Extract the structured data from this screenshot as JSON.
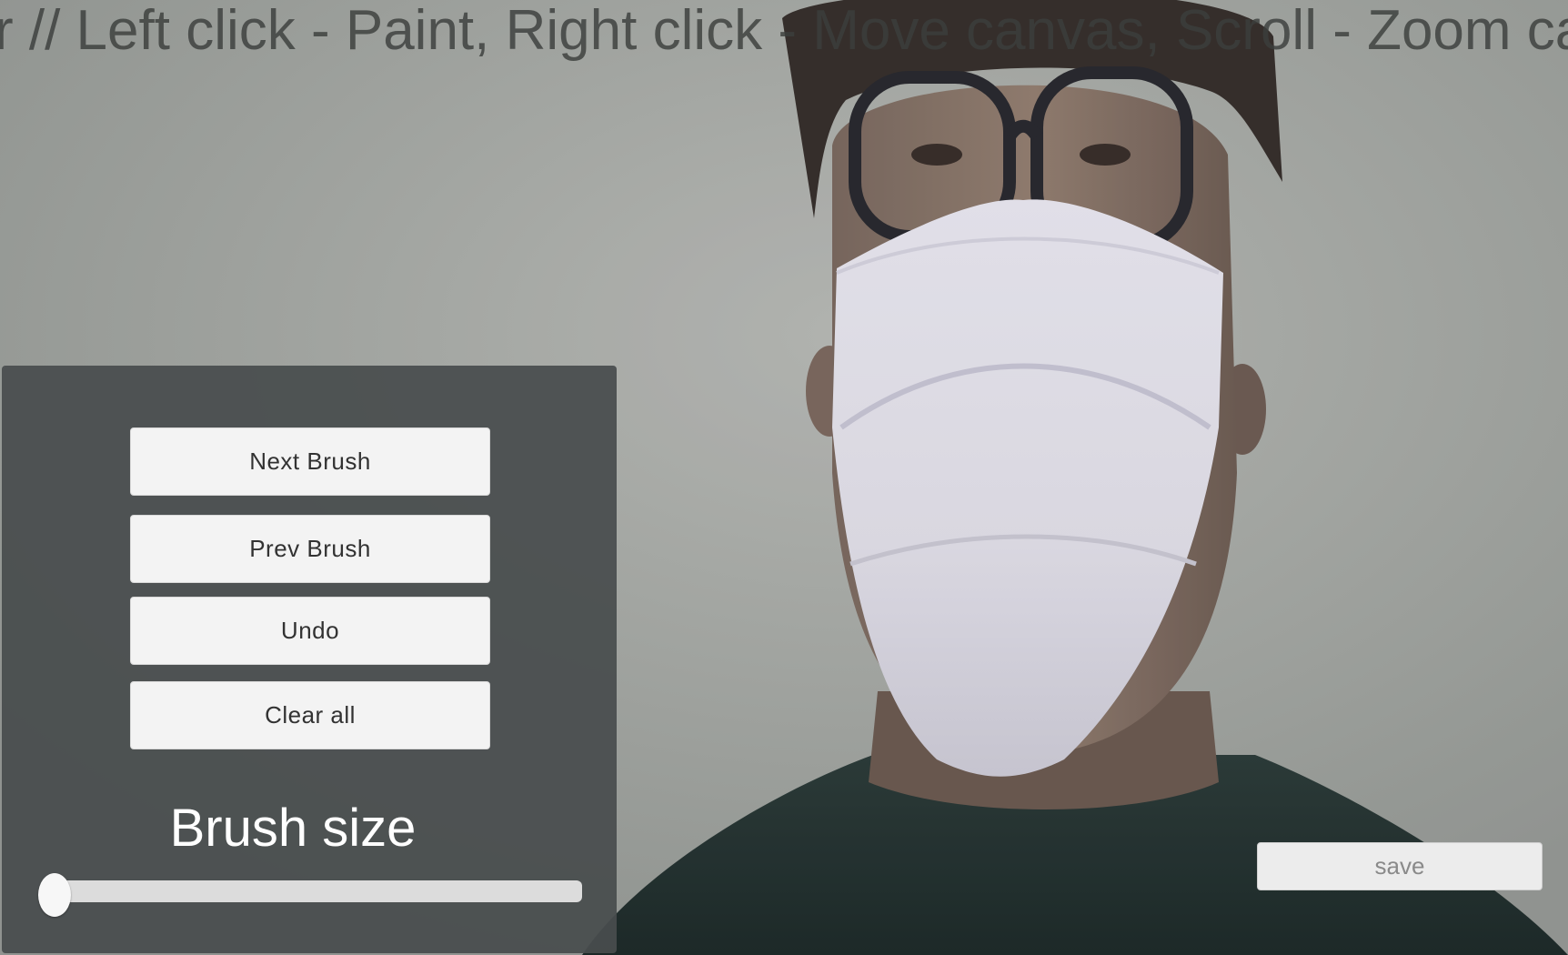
{
  "instruction_text": "r //  Left click - Paint, Right click - Move canvas, Scroll - Zoom canvas",
  "panel": {
    "buttons": {
      "next_brush": "Next Brush",
      "prev_brush": "Prev Brush",
      "undo": "Undo",
      "clear_all": "Clear all"
    },
    "brush_size_label": "Brush size",
    "brush_size_value": 0.0
  },
  "save_label": "save",
  "colors": {
    "panel_bg": "#484c4d",
    "button_bg": "#f3f3f3",
    "button_text": "#323232",
    "label_text": "#ffffff",
    "save_text": "#8a8a8a"
  }
}
